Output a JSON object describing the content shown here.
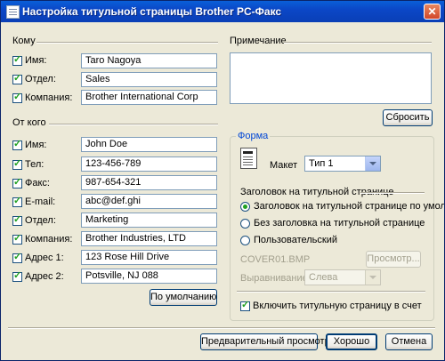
{
  "window": {
    "title": "Настройка титульной страницы Brother PC-Факс",
    "close_symbol": "✕"
  },
  "to": {
    "heading": "Кому",
    "fields": [
      {
        "label": "Имя:",
        "value": "Taro Nagoya",
        "checked": true
      },
      {
        "label": "Отдел:",
        "value": "Sales",
        "checked": true
      },
      {
        "label": "Компания:",
        "value": "Brother International Corp",
        "checked": true
      }
    ]
  },
  "from": {
    "heading": "От кого",
    "fields": [
      {
        "label": "Имя:",
        "value": "John Doe",
        "checked": true
      },
      {
        "label": "Тел:",
        "value": "123-456-789",
        "checked": true
      },
      {
        "label": "Факс:",
        "value": "987-654-321",
        "checked": true
      },
      {
        "label": "E-mail:",
        "value": "abc@def.ghi",
        "checked": true
      },
      {
        "label": "Отдел:",
        "value": "Marketing",
        "checked": true
      },
      {
        "label": "Компания:",
        "value": "Brother Industries, LTD",
        "checked": true
      },
      {
        "label": "Адрес 1:",
        "value": "123 Rose Hill Drive",
        "checked": true
      },
      {
        "label": "Адрес 2:",
        "value": "Potsville, NJ 088",
        "checked": true
      }
    ],
    "default_button": "По умолчанию"
  },
  "note": {
    "heading": "Примечание",
    "value": "",
    "reset_button": "Сбросить"
  },
  "form": {
    "group_title": "Форма",
    "layout_label": "Макет",
    "layout_value": "Тип 1",
    "header_heading": "Заголовок на титульной странице",
    "options": [
      {
        "label": "Заголовок на титульной странице по умолчанию",
        "selected": true
      },
      {
        "label": "Без заголовка на титульной странице",
        "selected": false
      },
      {
        "label": "Пользовательский",
        "selected": false
      }
    ],
    "file_name": "COVER01.BMP",
    "browse_button": "Просмотр...",
    "alignment_label": "Выравнивание",
    "alignment_value": "Слева",
    "count_checkbox": {
      "label": "Включить титульную страницу в счет",
      "checked": true
    }
  },
  "footer": {
    "preview_button": "Предварительный просмотр...",
    "ok_button": "Хорошо",
    "cancel_button": "Отмена"
  }
}
